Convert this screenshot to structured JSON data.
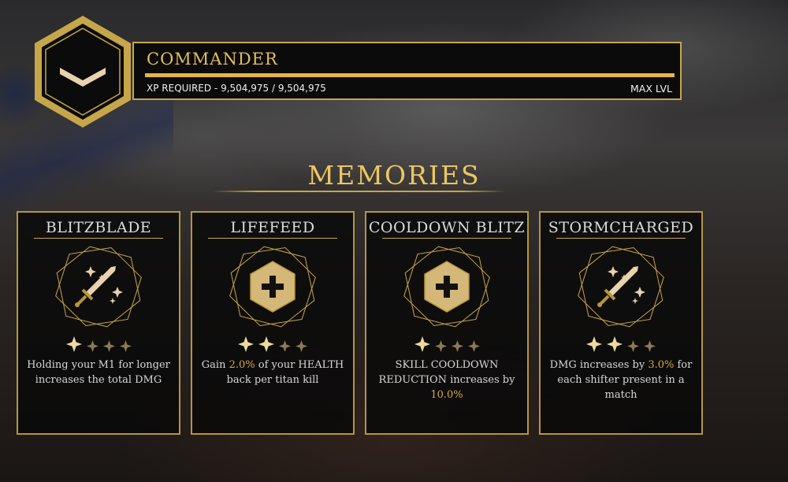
{
  "header": {
    "rank_name": "COMMANDER",
    "xp_label": "XP REQUIRED - ",
    "xp_current": "9,504,975",
    "xp_separator": " / ",
    "xp_required": "9,504,975",
    "xp_progress": 1.0,
    "max_level_label": "MAX LVL"
  },
  "section_title": "MEMORIES",
  "colors": {
    "gold": "#c7a64a",
    "highlight": "#d5a83c",
    "star_on": "#efd9a0",
    "star_off": "#8a7a55"
  },
  "cards": [
    {
      "title": "BLITZBLADE",
      "icon": "sword-sparkle-icon",
      "stars_filled": 1,
      "stars_total": 4,
      "desc_a": "Holding your M1 for longer increases the total DMG",
      "desc_highlight": "",
      "desc_b": ""
    },
    {
      "title": "LIFEFEED",
      "icon": "health-plus-icon",
      "stars_filled": 2,
      "stars_total": 4,
      "desc_a": "Gain ",
      "desc_highlight": "2.0%",
      "desc_b": " of your HEALTH back per titan kill"
    },
    {
      "title": "COOLDOWN BLITZ",
      "icon": "health-plus-icon",
      "stars_filled": 1,
      "stars_total": 4,
      "desc_a": "SKILL COOLDOWN REDUCTION increases by ",
      "desc_highlight": "10.0%",
      "desc_b": ""
    },
    {
      "title": "STORMCHARGED",
      "icon": "sword-sparkle-icon",
      "stars_filled": 2,
      "stars_total": 4,
      "desc_a": "DMG increases by ",
      "desc_highlight": "3.0%",
      "desc_b": " for each shifter present in a match"
    }
  ]
}
